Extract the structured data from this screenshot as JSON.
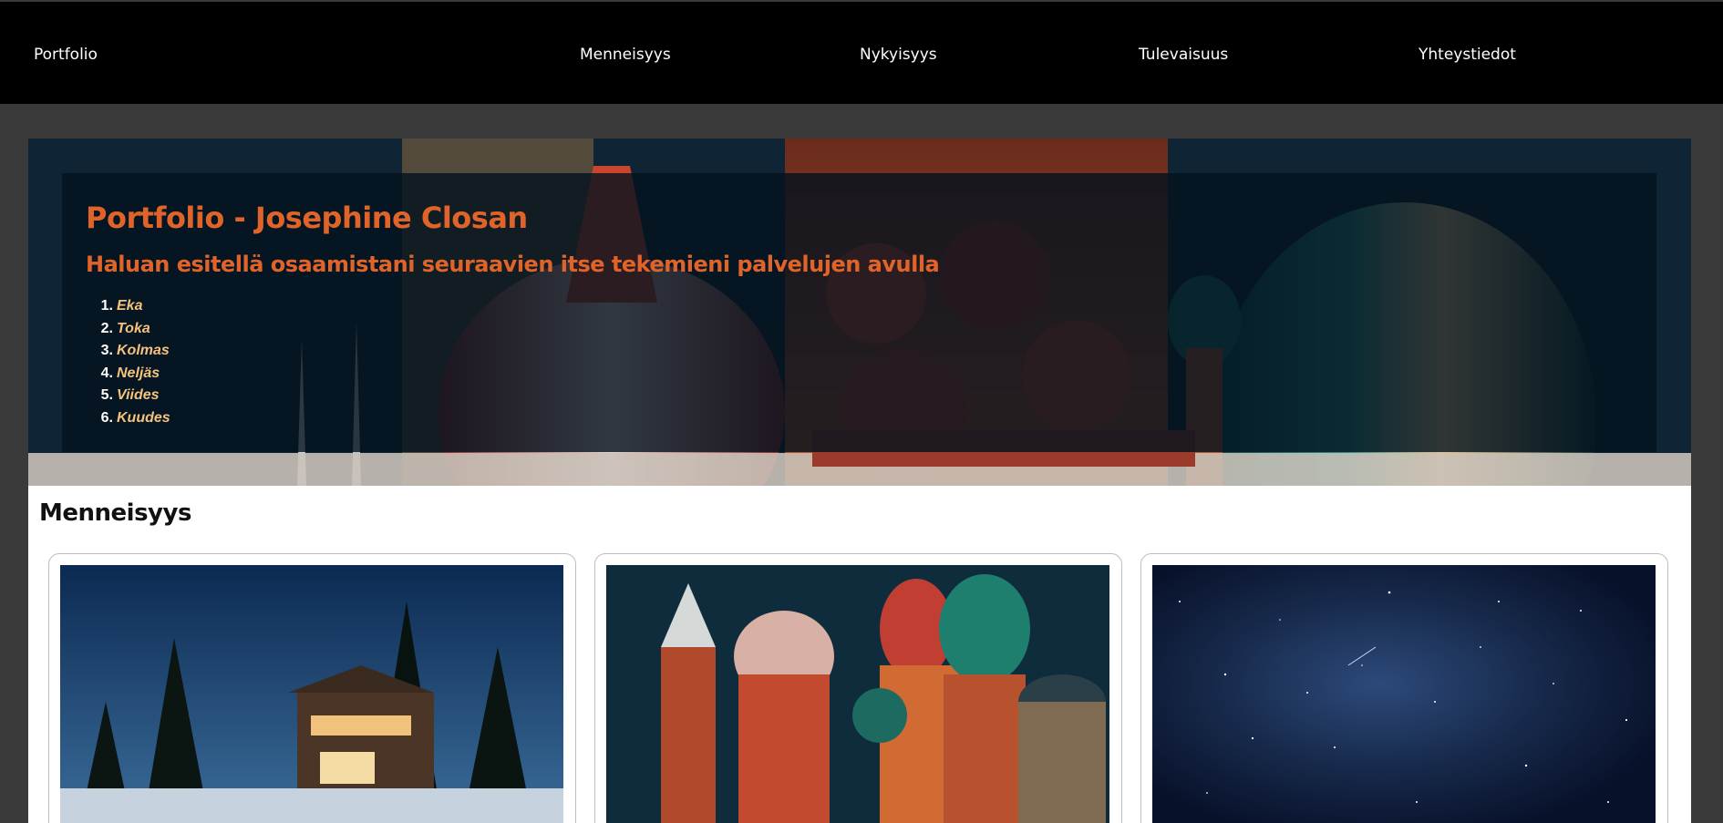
{
  "nav": {
    "brand": "Portfolio",
    "links": [
      "Menneisyys",
      "Nykyisyys",
      "Tulevaisuus",
      "Yhteystiedot"
    ]
  },
  "hero": {
    "title": "Portfolio - Josephine Closan",
    "subtitle": "Haluan esitellä osaamistani seuraavien itse tekemieni palvelujen avulla",
    "items": [
      {
        "num": "1.",
        "label": "Eka"
      },
      {
        "num": "2.",
        "label": "Toka"
      },
      {
        "num": "3.",
        "label": "Kolmas"
      },
      {
        "num": "4.",
        "label": "Neljäs"
      },
      {
        "num": "5.",
        "label": "Viides"
      },
      {
        "num": "6.",
        "label": "Kuudes"
      }
    ]
  },
  "section": {
    "title": "Menneisyys",
    "cards": [
      {
        "image": "snowy-house-night-image"
      },
      {
        "image": "cathedral-night-image"
      },
      {
        "image": "starry-sky-image"
      }
    ]
  },
  "colors": {
    "nav_bg": "#000000",
    "page_bg": "#3a3a3a",
    "hero_heading": "#e0642a",
    "list_label": "#f5c27d"
  }
}
